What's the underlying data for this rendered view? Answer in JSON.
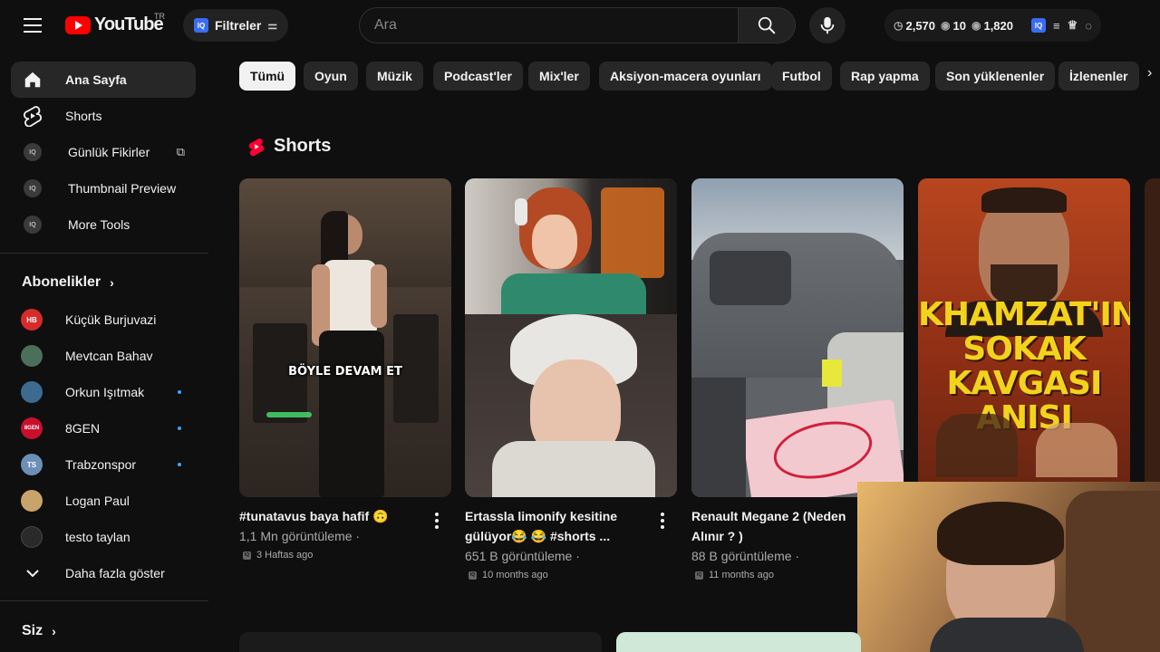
{
  "header": {
    "logo_text": "YouTube",
    "country": "TR",
    "filter_label": "Filtreler",
    "search_placeholder": "Ara",
    "stats": {
      "views": "2,570",
      "likes": "10",
      "watch": "1,820"
    },
    "brand_color": "#ff0000"
  },
  "sidebar": {
    "main": [
      {
        "label": "Ana Sayfa",
        "icon": "home-icon",
        "active": true
      },
      {
        "label": "Shorts",
        "icon": "shorts-icon"
      },
      {
        "label": "Günlük Fikirler",
        "icon": "iq-icon"
      },
      {
        "label": "Thumbnail Preview",
        "icon": "iq-icon"
      },
      {
        "label": "More Tools",
        "icon": "iq-icon"
      }
    ],
    "subscriptions_title": "Abonelikler",
    "subscriptions": [
      {
        "label": "Küçük Burjuvazi",
        "avatar_text": "HB",
        "color": "#d62b2b"
      },
      {
        "label": "Mevtcan Bahav",
        "avatar_text": "",
        "color": "#4b6f5a"
      },
      {
        "label": "Orkun Işıtmak",
        "avatar_text": "",
        "color": "#3d6b8f"
      },
      {
        "label": "8GEN",
        "avatar_text": "8GEN",
        "color": "#c8102e"
      },
      {
        "label": "Trabzonspor",
        "avatar_text": "TS",
        "color": "#6c8fb8"
      },
      {
        "label": "Logan Paul",
        "avatar_text": "",
        "color": "#c9a46a"
      },
      {
        "label": "testo taylan",
        "avatar_text": "",
        "color": "#2a2a2a"
      }
    ],
    "show_more": "Daha fazla göster",
    "you_title": "Siz"
  },
  "chips": [
    "Tümü",
    "Oyun",
    "Müzik",
    "Podcast'ler",
    "Mix'ler",
    "Aksiyon-macera oyunları",
    "Futbol",
    "Rap yapma",
    "Son yüklenenler",
    "İzlenenler"
  ],
  "shorts": {
    "title": "Shorts",
    "items": [
      {
        "title": "#tunatavus baya hafif 🙃",
        "views": "1,1 Mn görüntüleme ·",
        "age": "3 Haftas ago",
        "overlay": "BÖYLE DEVAM ET"
      },
      {
        "title": "Ertassla limonify kesitine gülüyor😂 😂 #shorts ...",
        "views": "651 B görüntüleme ·",
        "age": "10 months ago",
        "overlay": ""
      },
      {
        "title": "Renault Megane 2 (Neden Alınır ? )",
        "views": "88 B görüntüleme ·",
        "age": "11 months ago",
        "overlay": ""
      },
      {
        "title": "",
        "views": "",
        "age": "",
        "overlay": "KHAMZAT'IN SOKAK KAVGASI ANISI"
      }
    ]
  }
}
